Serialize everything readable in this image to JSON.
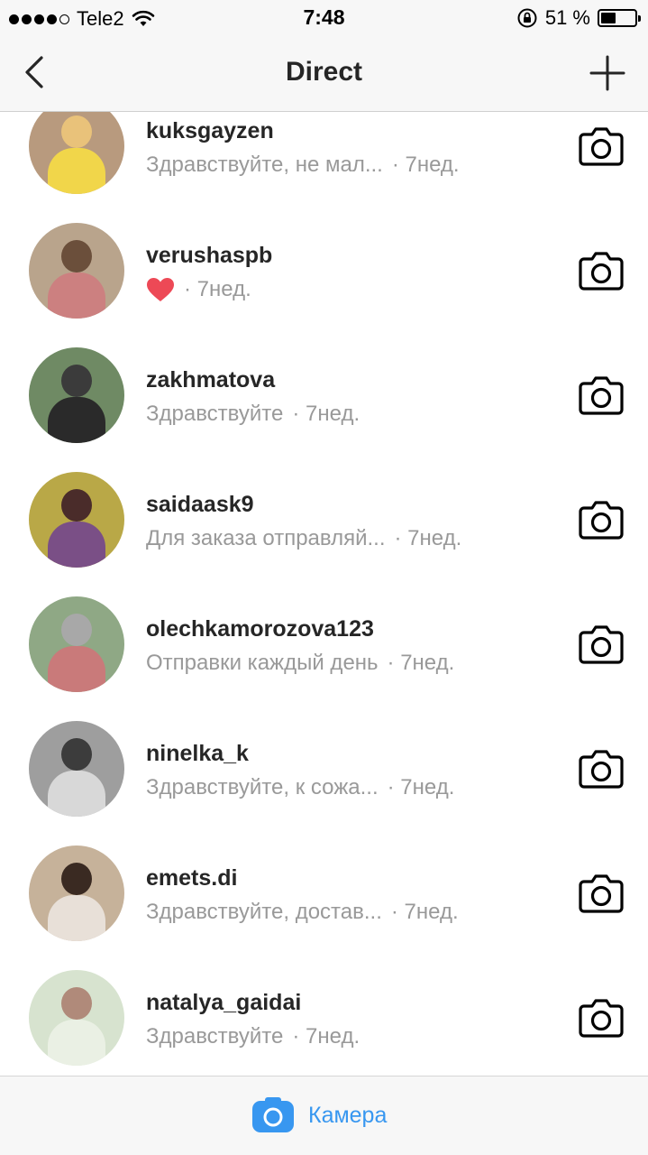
{
  "status_bar": {
    "carrier": "Tele2",
    "time": "7:48",
    "battery_percent_label": "51 %",
    "battery_level": 0.51,
    "icons": [
      "signal-dots",
      "wifi-icon",
      "rotation-lock-icon",
      "battery-icon"
    ]
  },
  "nav": {
    "title": "Direct",
    "back_icon": "chevron-left-icon",
    "add_icon": "plus-icon"
  },
  "threads": [
    {
      "username": "kuksgayzen",
      "preview": "Здравствуйте, не мал...",
      "time": "· 7нед.",
      "avatar_bg": "#b89a7e",
      "avatar_fg": "#e9c27a",
      "avatar_body": "#f1d64a",
      "heart": false
    },
    {
      "username": "verushaspb",
      "preview": "",
      "time": "· 7нед.",
      "avatar_bg": "#b9a48c",
      "avatar_fg": "#6b4f3b",
      "avatar_body": "#cc8080",
      "heart": true
    },
    {
      "username": "zakhmatova",
      "preview": "Здравствуйте",
      "time": "· 7нед.",
      "avatar_bg": "#6f8a64",
      "avatar_fg": "#3b3b3b",
      "avatar_body": "#2a2a2a",
      "heart": false
    },
    {
      "username": "saidaask9",
      "preview": "Для заказа отправляй...",
      "time": "· 7нед.",
      "avatar_bg": "#b9a847",
      "avatar_fg": "#4a2c2a",
      "avatar_body": "#7a4f86",
      "heart": false
    },
    {
      "username": "olechkamorozova123",
      "preview": "Отправки каждый день",
      "time": "· 7нед.",
      "avatar_bg": "#8fa885",
      "avatar_fg": "#a8a8a8",
      "avatar_body": "#c97a7a",
      "heart": false
    },
    {
      "username": "ninelka_k",
      "preview": "Здравствуйте, к сожа...",
      "time": "· 7нед.",
      "avatar_bg": "#9e9e9e",
      "avatar_fg": "#3c3c3c",
      "avatar_body": "#d8d8d8",
      "heart": false
    },
    {
      "username": "emets.di",
      "preview": "Здравствуйте, достав...",
      "time": "· 7нед.",
      "avatar_bg": "#c6b29a",
      "avatar_fg": "#3a2a22",
      "avatar_body": "#e8e0d8",
      "heart": false
    },
    {
      "username": "natalya_gaidai",
      "preview": "Здравствуйте",
      "time": "· 7нед.",
      "avatar_bg": "#d7e3cf",
      "avatar_fg": "#b08a7a",
      "avatar_body": "#eaf0e4",
      "heart": false
    }
  ],
  "bottom_bar": {
    "label": "Камера",
    "icon": "camera-filled-icon",
    "accent": "#3897f0"
  },
  "colors": {
    "bar_bg": "#f7f7f7",
    "username": "#262626",
    "preview": "#999999",
    "heart": "#ed4956"
  }
}
